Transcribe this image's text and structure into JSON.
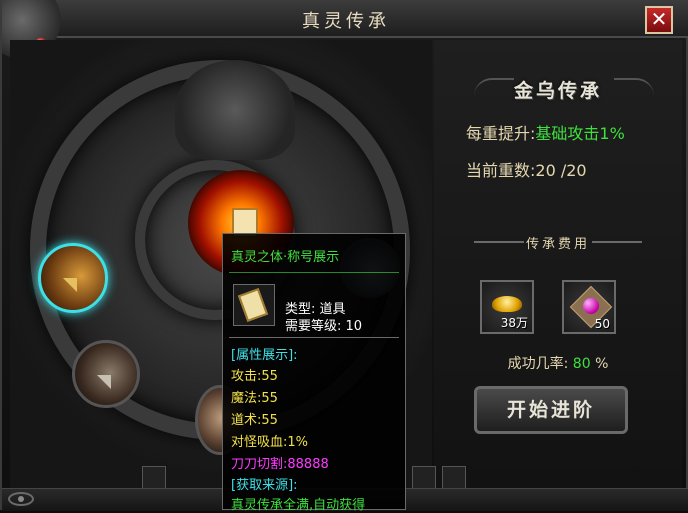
{
  "window": {
    "title": "真灵传承",
    "close_label": "✕"
  },
  "heritage": {
    "name": "金乌传承",
    "bonus_label": "每重提升:",
    "bonus_value": "基础攻击1%",
    "level_label": "当前重数:",
    "level_value": "20 /20"
  },
  "cost": {
    "title": "传承费用",
    "items": [
      {
        "icon": "gold-ingot-icon",
        "qty": "38万"
      },
      {
        "icon": "gem-box-icon",
        "qty": "50"
      }
    ]
  },
  "success": {
    "label": "成功几率:",
    "value": "80",
    "unit": "%"
  },
  "start_button": {
    "label": "开始进阶"
  },
  "tooltip": {
    "title": "真灵之体·称号展示",
    "type_label": "类型: 道具",
    "level_label": "需要等级: 10",
    "attr_header": "[属性展示]:",
    "attrs": [
      "攻击:55",
      "魔法:55",
      "道术:55",
      "对怪吸血:1%"
    ],
    "special": "刀刀切割:88888",
    "source_header": "[获取来源]:",
    "source_text": "真灵传承全满,自动获得"
  },
  "colors": {
    "green": "#3ee03e",
    "cyan": "#3ee0e8",
    "yellow": "#f2e24a",
    "magenta": "#ff3aff",
    "close": "#c62a2a"
  }
}
